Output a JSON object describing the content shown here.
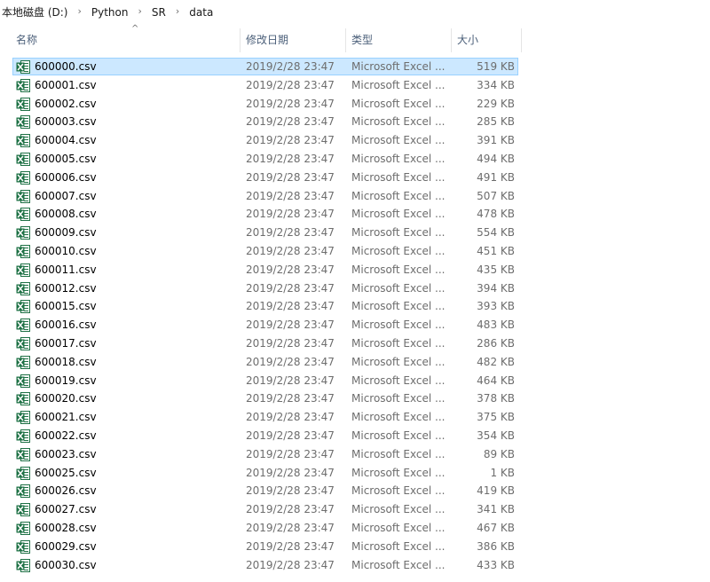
{
  "breadcrumb": [
    "本地磁盘 (D:)",
    "Python",
    "SR",
    "data"
  ],
  "columns": {
    "name": "名称",
    "date": "修改日期",
    "type": "类型",
    "size": "大小"
  },
  "colors": {
    "selected_bg": "#cce8ff",
    "selected_border": "#99d1ff",
    "header_text": "#4c607a",
    "excel_green": "#1e7145"
  },
  "files": [
    {
      "name": "600000.csv",
      "date": "2019/2/28 23:47",
      "type": "Microsoft Excel ...",
      "size": "519 KB",
      "selected": true
    },
    {
      "name": "600001.csv",
      "date": "2019/2/28 23:47",
      "type": "Microsoft Excel ...",
      "size": "334 KB"
    },
    {
      "name": "600002.csv",
      "date": "2019/2/28 23:47",
      "type": "Microsoft Excel ...",
      "size": "229 KB"
    },
    {
      "name": "600003.csv",
      "date": "2019/2/28 23:47",
      "type": "Microsoft Excel ...",
      "size": "285 KB"
    },
    {
      "name": "600004.csv",
      "date": "2019/2/28 23:47",
      "type": "Microsoft Excel ...",
      "size": "391 KB"
    },
    {
      "name": "600005.csv",
      "date": "2019/2/28 23:47",
      "type": "Microsoft Excel ...",
      "size": "494 KB"
    },
    {
      "name": "600006.csv",
      "date": "2019/2/28 23:47",
      "type": "Microsoft Excel ...",
      "size": "491 KB"
    },
    {
      "name": "600007.csv",
      "date": "2019/2/28 23:47",
      "type": "Microsoft Excel ...",
      "size": "507 KB"
    },
    {
      "name": "600008.csv",
      "date": "2019/2/28 23:47",
      "type": "Microsoft Excel ...",
      "size": "478 KB"
    },
    {
      "name": "600009.csv",
      "date": "2019/2/28 23:47",
      "type": "Microsoft Excel ...",
      "size": "554 KB"
    },
    {
      "name": "600010.csv",
      "date": "2019/2/28 23:47",
      "type": "Microsoft Excel ...",
      "size": "451 KB"
    },
    {
      "name": "600011.csv",
      "date": "2019/2/28 23:47",
      "type": "Microsoft Excel ...",
      "size": "435 KB"
    },
    {
      "name": "600012.csv",
      "date": "2019/2/28 23:47",
      "type": "Microsoft Excel ...",
      "size": "394 KB"
    },
    {
      "name": "600015.csv",
      "date": "2019/2/28 23:47",
      "type": "Microsoft Excel ...",
      "size": "393 KB"
    },
    {
      "name": "600016.csv",
      "date": "2019/2/28 23:47",
      "type": "Microsoft Excel ...",
      "size": "483 KB"
    },
    {
      "name": "600017.csv",
      "date": "2019/2/28 23:47",
      "type": "Microsoft Excel ...",
      "size": "286 KB"
    },
    {
      "name": "600018.csv",
      "date": "2019/2/28 23:47",
      "type": "Microsoft Excel ...",
      "size": "482 KB"
    },
    {
      "name": "600019.csv",
      "date": "2019/2/28 23:47",
      "type": "Microsoft Excel ...",
      "size": "464 KB"
    },
    {
      "name": "600020.csv",
      "date": "2019/2/28 23:47",
      "type": "Microsoft Excel ...",
      "size": "378 KB"
    },
    {
      "name": "600021.csv",
      "date": "2019/2/28 23:47",
      "type": "Microsoft Excel ...",
      "size": "375 KB"
    },
    {
      "name": "600022.csv",
      "date": "2019/2/28 23:47",
      "type": "Microsoft Excel ...",
      "size": "354 KB"
    },
    {
      "name": "600023.csv",
      "date": "2019/2/28 23:47",
      "type": "Microsoft Excel ...",
      "size": "89 KB"
    },
    {
      "name": "600025.csv",
      "date": "2019/2/28 23:47",
      "type": "Microsoft Excel ...",
      "size": "1 KB"
    },
    {
      "name": "600026.csv",
      "date": "2019/2/28 23:47",
      "type": "Microsoft Excel ...",
      "size": "419 KB"
    },
    {
      "name": "600027.csv",
      "date": "2019/2/28 23:47",
      "type": "Microsoft Excel ...",
      "size": "341 KB"
    },
    {
      "name": "600028.csv",
      "date": "2019/2/28 23:47",
      "type": "Microsoft Excel ...",
      "size": "467 KB"
    },
    {
      "name": "600029.csv",
      "date": "2019/2/28 23:47",
      "type": "Microsoft Excel ...",
      "size": "386 KB"
    },
    {
      "name": "600030.csv",
      "date": "2019/2/28 23:47",
      "type": "Microsoft Excel ...",
      "size": "433 KB"
    }
  ]
}
